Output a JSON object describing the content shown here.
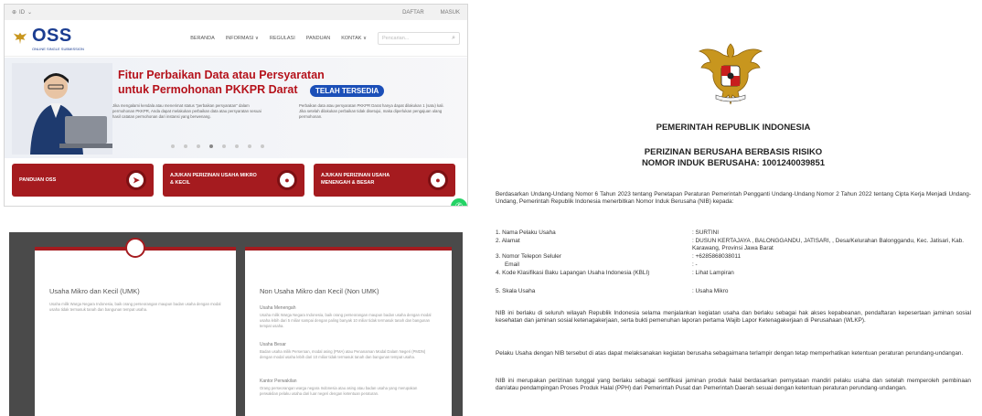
{
  "site": {
    "topbar": {
      "lang": "ID",
      "daftar": "DAFTAR",
      "masuk": "MASUK"
    },
    "logo_text": "OSS",
    "logo_sub": "ONLINE SINGLE SUBMISSION",
    "nav": [
      "BERANDA",
      "INFORMASI ∨",
      "REGULASI",
      "PANDUAN",
      "KONTAK ∨"
    ],
    "search_placeholder": "Pencarian...",
    "hero": {
      "title1": "Fitur Perbaikan Data atau Persyaratan",
      "title2": "untuk Permohonan PKKPR Darat",
      "badge": "TELAH TERSEDIA",
      "info_left": "Jika mengalami kendala atau menerimat status \"perbaikan persyaratan\" dalam permohonan PKKPR, Anda dapat melakukan perbaikan data atau persyaratan sesuai hasil catatan permohonan dari instansi yang berwenang.",
      "info_right": "Perbaikan data atau persyaratan PKKPR Darat hanya dapat dilakukan 1 (satu) kali. Jika setelah dilakukan perbaikan tidak disetujui, maka diperlukan pengajuan ulang permohonan."
    },
    "cards": [
      {
        "label": "PANDUAN OSS",
        "icon": "compass-icon"
      },
      {
        "label": "AJUKAN PERIZINAN USAHA MIKRO & KECIL",
        "icon": "oss-icon"
      },
      {
        "label": "AJUKAN PERIZINAN USAHA MENENGAH & BESAR",
        "icon": "oss-icon"
      }
    ]
  },
  "lower": {
    "umk_title": "Usaha Mikro dan Kecil (UMK)",
    "umk_text": "Usaha milik Warga Negara Indonesia, baik orang perseorangan maupun badan usaha dengan modal usaha tidak termasuk tanah dan bangunan tempat usaha.",
    "non_title": "Non Usaha Mikro dan Kecil (Non UMK)",
    "sections": [
      {
        "title": "Usaha Menengah",
        "text": "Usaha milik Warga Negara Indonesia, baik orang perseorangan maupun badan usaha dengan modal usaha lebih dari 5 miliar sampai dengan paling banyak 10 miliar tidak termasuk tanah dan bangunan tempat usaha."
      },
      {
        "title": "Usaha Besar",
        "text": "Badan usaha milik Perseroan, modal asing (PMA) atau Penanaman Modal Dalam Negeri (PMDN) dengan modal usaha lebih dari 10 miliar tidak termasuk tanah dan bangunan tempat usaha."
      },
      {
        "title": "Kantor Perwakilan",
        "text": "Orang perseorangan warga negara Indonesia atau asing atau badan usaha yang merupakan perwakilan pelaku usaha dari luar negeri dengan ketentuan peraturan."
      }
    ]
  },
  "doc": {
    "t1": "PEMERINTAH REPUBLIK INDONESIA",
    "t2": "PERIZINAN BERUSAHA BERBASIS RISIKO",
    "t3": "NOMOR INDUK BERUSAHA: 1001240039851",
    "intro": "Berdasarkan Undang-Undang Nomor 6 Tahun 2023 tentang Penetapan Peraturan Pemerintah Pengganti Undang-Undang Nomor 2 Tahun 2022 tentang Cipta Kerja Menjadi Undang-Undang, Pemerintah Republik Indonesia menerbitkan Nomor Induk Berusaha (NIB) kepada:",
    "rows": [
      {
        "k": "1. Nama Pelaku Usaha",
        "v": ": SURTINI"
      },
      {
        "k": "2. Alamat",
        "v": ": DUSUN KERTAJAYA , BALONGGANDU, JATISARI, , Desa/Kelurahan Balonggandu, Kec. Jatisari, Kab. Karawang, Provinsi Jawa Barat"
      },
      {
        "k": "3. Nomor Telepon Seluler",
        "v": ": +6285868038011"
      },
      {
        "k": "    Email",
        "v": ": -"
      },
      {
        "k": "4. Kode Klasifikasi Baku Lapangan Usaha Indonesia (KBLI)",
        "v": ": Lihat Lampiran"
      },
      {
        "k": "5. Skala Usaha",
        "v": ": Usaha Mikro"
      }
    ],
    "p1": "NIB ini berlaku di seluruh wilayah Republik Indonesia selama menjalankan kegiatan usaha dan berlaku sebagai hak akses kepabeanan, pendaftaran kepesertaan jaminan sosial kesehatan dan jaminan sosial ketenagakerjaan, serta bukti pemenuhan laporan pertama Wajib Lapor Ketenagakerjaan di Perusahaan (WLKP).",
    "p2": "Pelaku Usaha dengan NIB tersebut di atas dapat melaksanakan kegiatan berusaha sebagaimana terlampir dengan tetap memperhatikan ketentuan peraturan perundang-undangan.",
    "p3": "NIB ini merupakan perizinan tunggal yang berlaku sebagai sertifikasi jaminan produk halal berdasarkan pernyataan mandiri pelaku usaha dan setelah memperoleh pembinaan dan/atau pendampingan Proses Produk Halal (PPH) dari Pemerintah Pusat dan Pemerintah Daerah sesuai dengan ketentuan peraturan perundang-undangan."
  }
}
